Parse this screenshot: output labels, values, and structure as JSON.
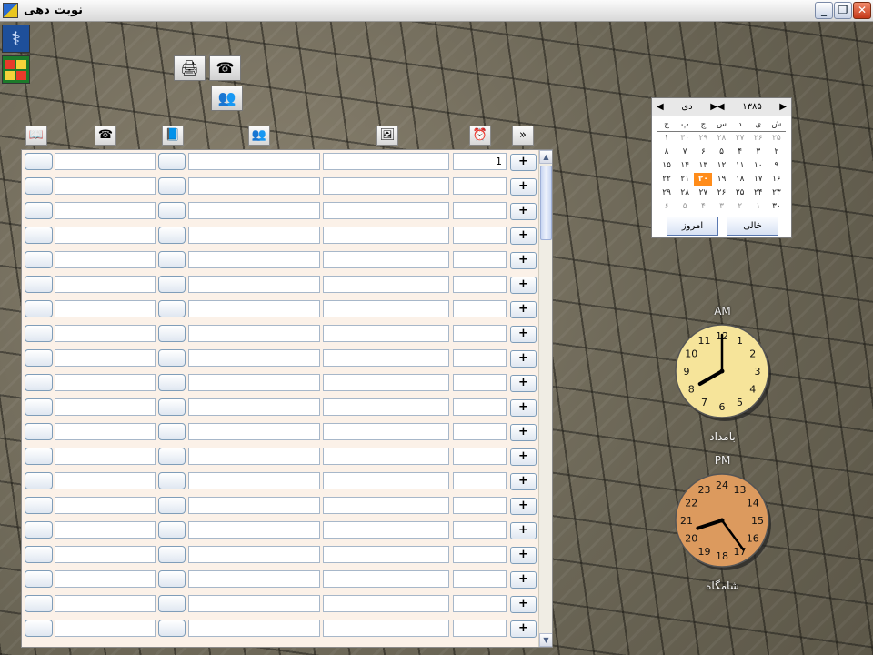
{
  "window": {
    "title": "نوبت دهی",
    "minimize": "_",
    "restore": "❐",
    "close": "✕"
  },
  "sidebar": {
    "items": [
      {
        "icon": "caduceus-icon"
      },
      {
        "icon": "tiles-icon"
      }
    ]
  },
  "toolbar": {
    "icons": [
      "printer-report-icon",
      "phone-icon",
      "patients-icon"
    ]
  },
  "columns": {
    "icons": [
      "book-icon",
      "phone-icon",
      "file-icon",
      "people-icon",
      "picture-icon",
      "alarm-clock-icon",
      "expand-down-icon"
    ]
  },
  "grid": {
    "rows": [
      {
        "number": "1"
      },
      {
        "number": ""
      },
      {
        "number": ""
      },
      {
        "number": ""
      },
      {
        "number": ""
      },
      {
        "number": ""
      },
      {
        "number": ""
      },
      {
        "number": ""
      },
      {
        "number": ""
      },
      {
        "number": ""
      },
      {
        "number": ""
      },
      {
        "number": ""
      },
      {
        "number": ""
      },
      {
        "number": ""
      },
      {
        "number": ""
      },
      {
        "number": ""
      },
      {
        "number": ""
      },
      {
        "number": ""
      },
      {
        "number": ""
      },
      {
        "number": ""
      }
    ],
    "plus_label": "+"
  },
  "calendar": {
    "year": "۱۳۸۵",
    "month": "دی",
    "weekdays": [
      "ش",
      "ی",
      "د",
      "س",
      "چ",
      "پ",
      "ج"
    ],
    "weeks": [
      [
        "۲۵",
        "۲۶",
        "۲۷",
        "۲۸",
        "۲۹",
        "۳۰",
        "۱"
      ],
      [
        "۲",
        "۳",
        "۴",
        "۵",
        "۶",
        "۷",
        "۸"
      ],
      [
        "۹",
        "۱۰",
        "۱۱",
        "۱۲",
        "۱۳",
        "۱۴",
        "۱۵"
      ],
      [
        "۱۶",
        "۱۷",
        "۱۸",
        "۱۹",
        "۲۰",
        "۲۱",
        "۲۲"
      ],
      [
        "۲۳",
        "۲۴",
        "۲۵",
        "۲۶",
        "۲۷",
        "۲۸",
        "۲۹"
      ],
      [
        "۳۰",
        "۱",
        "۲",
        "۳",
        "۴",
        "۵",
        "۶"
      ]
    ],
    "today": "۲۰",
    "clear_label": "خالی",
    "today_label": "امروز"
  },
  "clocks": {
    "am": {
      "tag": "AM",
      "name": "بامداد",
      "hour": 8,
      "minute": 0,
      "face": "#f6e49a",
      "numbers": [
        "12",
        "1",
        "2",
        "3",
        "4",
        "5",
        "6",
        "7",
        "8",
        "9",
        "10",
        "11"
      ]
    },
    "pm": {
      "tag": "PM",
      "name": "شامگاه",
      "hour": 20,
      "minute": 24,
      "face": "#dc9a5e",
      "numbers": [
        "24",
        "13",
        "14",
        "15",
        "16",
        "17",
        "18",
        "19",
        "20",
        "21",
        "22",
        "23"
      ]
    }
  }
}
